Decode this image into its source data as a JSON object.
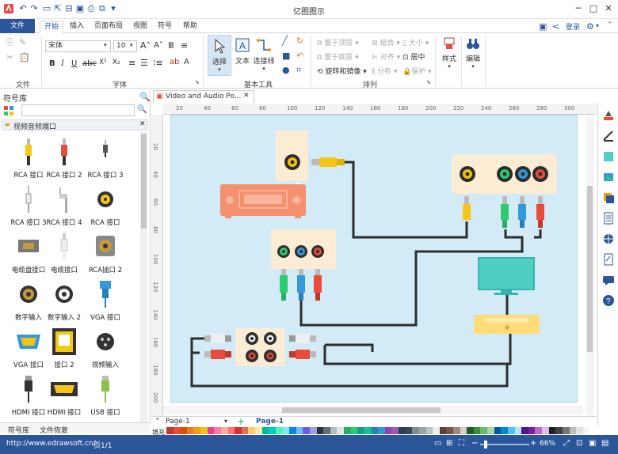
{
  "window": {
    "title": "亿图图示"
  },
  "tabs": [
    "文件",
    "开始",
    "插入",
    "页面布局",
    "视图",
    "符号",
    "帮助"
  ],
  "account": {
    "login": "登录"
  },
  "ribbon": {
    "file_group": {
      "label": "文件"
    },
    "font_group": {
      "label": "字体",
      "font_name": "宋体",
      "font_size": "10"
    },
    "basic_tools": {
      "label": "基本工具",
      "select": "选择",
      "text": "文本",
      "connector": "连接线"
    },
    "arrange": {
      "label": "排列",
      "bring_front": "置于顶层",
      "send_back": "置于底层",
      "rotate_mirror": "旋转和镜像",
      "group": "组合",
      "align": "对齐",
      "distribute": "分布",
      "size": "大小",
      "center": "居中",
      "protect": "保护"
    },
    "style": {
      "label": "样式"
    },
    "edit": {
      "label": "编辑"
    }
  },
  "library": {
    "title": "符号库",
    "category": "视频音频端口",
    "symbols": [
      "RCA 接口",
      "RCA 接口 2",
      "RCA 接口 3",
      "RCA 接口 3",
      "RCA 接口 4",
      "RCA 接口",
      "电缆盘接口",
      "电缆接口",
      "RCA插口 2",
      "数字输入",
      "数字输入 2",
      "VGA 接口",
      "VGA 接口",
      "接口 2",
      "视频输入",
      "HDMI 接口",
      "HDMI 接口",
      "USB 接口"
    ],
    "bottom_tabs": [
      "符号库",
      "文件恢复"
    ]
  },
  "document": {
    "tab_title": "Video and Audio Po..."
  },
  "ruler": {
    "h_ticks": [
      "20",
      "40",
      "60",
      "80",
      "100",
      "120",
      "140",
      "160",
      "180",
      "200",
      "220",
      "240",
      "260",
      "280",
      "300"
    ],
    "v_ticks": [
      "20",
      "40",
      "60",
      "80",
      "100",
      "120",
      "140",
      "160",
      "180",
      "200"
    ]
  },
  "pages": {
    "tab1": "Page-1",
    "active": "Page-1"
  },
  "palette_label": "填充",
  "status": {
    "url": "http://www.edrawsoft.cn/",
    "page": "页1/1",
    "zoom": "66%"
  },
  "colors": {
    "accent": "#2b579a",
    "canvas": "#d2ebf6",
    "amplifier": "#f5906e",
    "tv": "#4fcfc4",
    "player": "#fddc78",
    "cable": "#2d2d2d"
  }
}
